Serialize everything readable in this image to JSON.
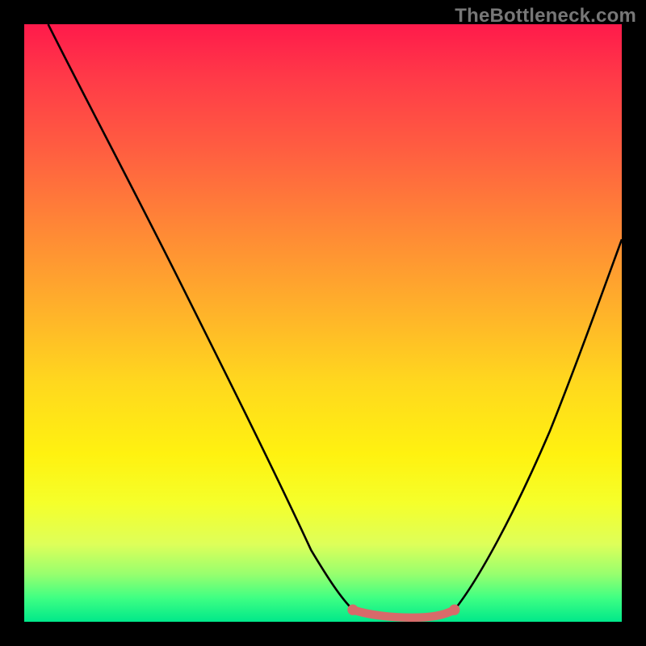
{
  "attribution": "TheBottleneck.com",
  "chart_data": {
    "type": "line",
    "title": "",
    "xlabel": "",
    "ylabel": "",
    "xlim": [
      0,
      100
    ],
    "ylim": [
      0,
      100
    ],
    "gradient_axis": "y",
    "gradient_stops": [
      {
        "offset": 0,
        "color": "#ff1a4b"
      },
      {
        "offset": 9,
        "color": "#ff3a48"
      },
      {
        "offset": 22,
        "color": "#ff6140"
      },
      {
        "offset": 34,
        "color": "#ff8736"
      },
      {
        "offset": 48,
        "color": "#ffb22a"
      },
      {
        "offset": 60,
        "color": "#ffd81e"
      },
      {
        "offset": 72,
        "color": "#fff210"
      },
      {
        "offset": 80,
        "color": "#f5ff2a"
      },
      {
        "offset": 87,
        "color": "#deff59"
      },
      {
        "offset": 92,
        "color": "#98ff6e"
      },
      {
        "offset": 96,
        "color": "#3fff83"
      },
      {
        "offset": 100,
        "color": "#00e88a"
      }
    ],
    "series": [
      {
        "name": "left-curve",
        "x": [
          4,
          10,
          18,
          26,
          34,
          42,
          48,
          52,
          55
        ],
        "y": [
          100,
          88,
          73,
          57,
          41,
          25,
          12,
          5,
          2
        ]
      },
      {
        "name": "right-curve",
        "x": [
          72,
          76,
          82,
          88,
          94,
          100
        ],
        "y": [
          2,
          7,
          18,
          32,
          48,
          64
        ]
      },
      {
        "name": "valley-marker",
        "style": "thick-salmon",
        "x": [
          55,
          60,
          65,
          70,
          72
        ],
        "y": [
          2,
          1,
          1,
          1,
          2
        ]
      }
    ],
    "marker_points": [
      {
        "x": 55,
        "y": 2
      },
      {
        "x": 72,
        "y": 2
      }
    ],
    "colors": {
      "curve": "#000000",
      "marker": "#d86a6a"
    }
  }
}
